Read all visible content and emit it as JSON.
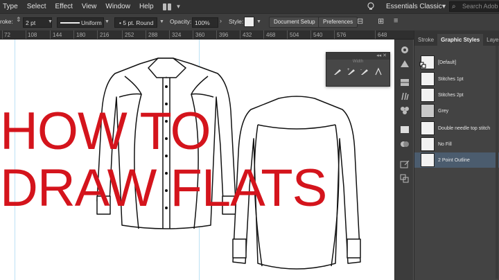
{
  "menu": {
    "items": [
      "Type",
      "Select",
      "Effect",
      "View",
      "Window",
      "Help"
    ],
    "workspace": "Essentials Classic",
    "search_placeholder": "Search Adobe"
  },
  "control_bar": {
    "stroke_label": "roke:",
    "stroke_weight": "2 pt",
    "profile": "Uniform",
    "brush": "5 pt. Round",
    "opacity_label": "Opacity:",
    "opacity_value": "100%",
    "style_label": "Style:",
    "doc_setup": "Document Setup",
    "preferences": "Preferences"
  },
  "ruler": {
    "ticks": [
      "72",
      "108",
      "144",
      "180",
      "216",
      "252",
      "288",
      "324",
      "360",
      "396",
      "432",
      "468",
      "504",
      "540",
      "576",
      "648"
    ]
  },
  "headline": {
    "line1": "HOW TO",
    "line2": "DRAW FLATS"
  },
  "panel": {
    "tabs": [
      "Stroke",
      "Graphic Styles",
      "Layers"
    ],
    "active_tab": "Graphic Styles",
    "styles": [
      "[Default]",
      "Stitches 1pt",
      "Stitches 2pt",
      "Grey",
      "Double needle top stitch",
      "No Fill",
      "2 Point Outline"
    ],
    "selected_style": "2 Point Outline"
  },
  "brush_panel": {
    "title": "Width"
  },
  "colors": {
    "headline": "#d4141c",
    "canvas": "#ffffff",
    "ui_dark": "#323232",
    "selection": "#4b5c6e"
  }
}
